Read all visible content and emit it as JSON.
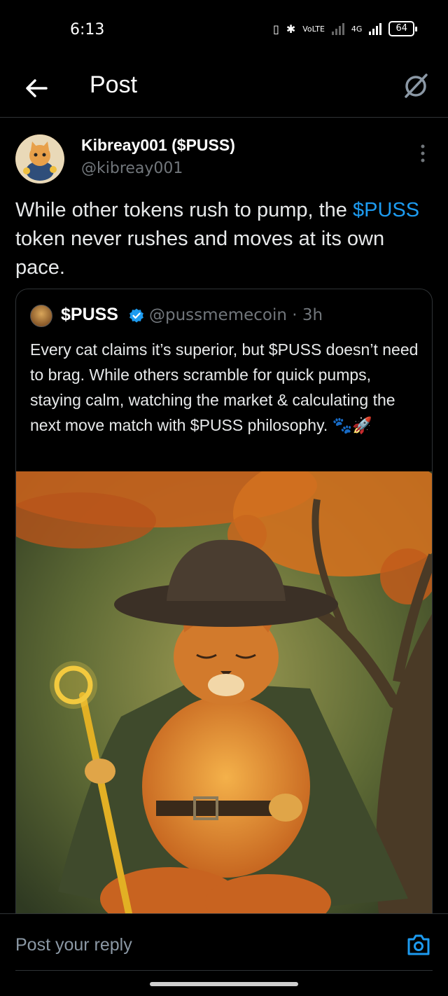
{
  "status": {
    "time": "6:13",
    "network_label": "VoLTE",
    "network_type": "4G",
    "battery": "64"
  },
  "header": {
    "title": "Post"
  },
  "post": {
    "author_name": "Kibreay001 ($PUSS)",
    "author_handle": "@kibreay001",
    "text_before": "While other tokens rush to pump, the ",
    "cashtag": "$PUSS",
    "text_after": " token never rushes and moves at its own pace."
  },
  "quote": {
    "name": "$PUSS",
    "handle_time": "@pussmemecoin · 3h",
    "text": "Every cat claims it’s superior, but $PUSS doesn’t need to brag. While others scramble for quick pumps, staying calm, watching the market & calculating the next move match with $PUSS philosophy. 🐾🚀"
  },
  "reply": {
    "placeholder": "Post your reply"
  },
  "colors": {
    "accent": "#1d9bf0",
    "background": "#000000",
    "muted": "#71767b"
  },
  "icons": [
    "back-arrow-icon",
    "grok-icon",
    "more-vertical-icon",
    "verified-badge-icon",
    "camera-icon"
  ]
}
